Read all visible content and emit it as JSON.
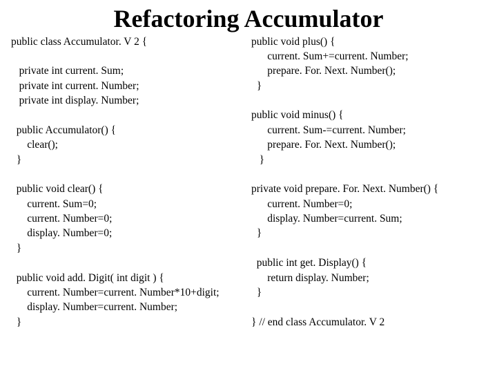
{
  "title": "Refactoring Accumulator",
  "left": {
    "l1": "public class Accumulator. V 2 {",
    "l2": "",
    "l3": "   private int current. Sum;",
    "l4": "   private int current. Number;",
    "l5": "   private int display. Number;",
    "l6": "",
    "l7": "  public Accumulator() {",
    "l8": "      clear();",
    "l9": "  }",
    "l10": "",
    "l11": "  public void clear() {",
    "l12": "      current. Sum=0;",
    "l13": "      current. Number=0;",
    "l14": "      display. Number=0;",
    "l15": "  }",
    "l16": "",
    "l17": "  public void add. Digit( int digit ) {",
    "l18": "      current. Number=current. Number*10+digit;",
    "l19": "      display. Number=current. Number;",
    "l20": "  }"
  },
  "right": {
    "l1": "public void plus() {",
    "l2": "      current. Sum+=current. Number;",
    "l3": "      prepare. For. Next. Number();",
    "l4": "  }",
    "l5": "",
    "l6": "public void minus() {",
    "l7": "      current. Sum-=current. Number;",
    "l8": "      prepare. For. Next. Number();",
    "l9": "   }",
    "l10": "",
    "l11": "private void prepare. For. Next. Number() {",
    "l12": "      current. Number=0;",
    "l13": "      display. Number=current. Sum;",
    "l14": "  }",
    "l15": "",
    "l16": "  public int get. Display() {",
    "l17": "      return display. Number;",
    "l18": "  }",
    "l19": "",
    "l20": "} // end class Accumulator. V 2"
  }
}
